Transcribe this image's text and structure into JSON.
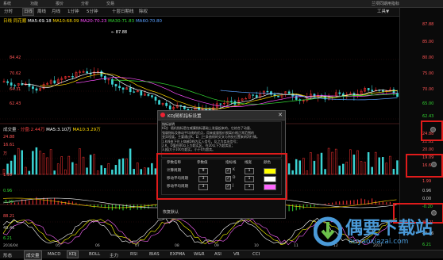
{
  "menu": {
    "items": [
      "系统",
      "功能",
      "报价",
      "分析",
      "交易"
    ],
    "right": "兰坝同期用指标"
  },
  "toolbar": {
    "buttons": [
      {
        "label": "分时",
        "active": false
      },
      {
        "label": "日线",
        "active": true
      },
      {
        "label": "周线",
        "active": false
      },
      {
        "label": "月线",
        "active": false
      },
      {
        "label": "1分钟",
        "active": false
      },
      {
        "label": "5分钟",
        "active": false
      },
      {
        "label": "十层日期线",
        "active": false
      },
      {
        "label": "除权",
        "active": false
      }
    ],
    "right_label": "工具▼"
  },
  "price_panel": {
    "legend_prefix": "日线 同花顺",
    "ma": [
      {
        "label": "MA5:69.18",
        "color": "#ffffff"
      },
      {
        "label": "MA10:68.09",
        "color": "#ffd700"
      },
      {
        "label": "MA20:70.23",
        "color": "#ff4fff"
      },
      {
        "label": "MA30:71.83",
        "color": "#33d833"
      },
      {
        "label": "MA60:70.80",
        "color": "#5aa0ff"
      }
    ],
    "peak_label": "← 87.88",
    "axis": [
      "84.42",
      "70.62",
      "64.31",
      "62.43"
    ]
  },
  "volume_panel": {
    "legend_prefix": "成交量",
    "items": [
      {
        "label": "· 分盘:2.44万",
        "color": "#ff4444"
      },
      {
        "label": "MA5:3.10万",
        "color": "#ffffff"
      },
      {
        "label": "MA10:3.29万",
        "color": "#ffd700"
      }
    ],
    "axis": [
      "24.88",
      "16.61",
      "万"
    ]
  },
  "macd_panel": {
    "axis": [
      "1.99",
      "0.96",
      "-0.20"
    ]
  },
  "kdj_panel": {
    "axis": [
      "88.21",
      "49.46",
      "6.21"
    ]
  },
  "date_axis": [
    "2016/04",
    "05",
    "06",
    "07",
    "08",
    "09",
    "10",
    "11",
    "12",
    "2017"
  ],
  "right_axis": {
    "price": [
      "87.88",
      "85.00",
      "80.00",
      "75.00",
      "70.00",
      "65.00",
      "62.43"
    ],
    "volume": [
      "24.88",
      "22.82",
      "20.00",
      "19.09",
      "16.61"
    ],
    "macd": [
      "1.99",
      "0.96",
      "0.00",
      "-0.20"
    ],
    "kdj": [
      "88.21",
      "49.46",
      "6.21"
    ]
  },
  "dialog": {
    "title": "KDJ随机指标设置",
    "close": "✕",
    "desc_title": "指标说明",
    "desc_lines": [
      "KDJ：随机指标是在威廉指标基础上发展起来的，它综合了动量、",
      "强弱指标及移动平均线的优点，用来度量股价脱离价格正常范围的",
      "变异程度。主要通过K、D、J三条曲线的交叉与所处位置来研判行情。",
      "1.K线由下往上穿越D线为买入信号，反之为卖出信号；",
      "2.K、D值在80以上为超买区，在20以下为超卖区；",
      "3.J值大于100为超买，小于0为超卖。"
    ],
    "param_headers": [
      "参数名称",
      "参数值",
      "指标线",
      "线宽",
      "颜色"
    ],
    "params": [
      {
        "name": "计算周期",
        "value": "9",
        "line": "K",
        "width": "1",
        "color": "#ffff00"
      },
      {
        "name": "移动平均周期",
        "value": "3",
        "line": "D",
        "width": "1",
        "color": "#ffffff"
      },
      {
        "name": "移动平均周期",
        "value": "3",
        "line": "J",
        "width": "1",
        "color": "#ff66ff"
      }
    ],
    "reset": "恢复默认"
  },
  "bottom_tabs": [
    {
      "label": "形态",
      "active": false
    },
    {
      "label": "成交量",
      "active": true
    },
    {
      "label": "MACD",
      "active": false
    },
    {
      "label": "KDJ",
      "active": true
    },
    {
      "label": "BOLL",
      "active": false
    },
    {
      "label": "主力",
      "active": false
    },
    {
      "label": "RSI",
      "active": false
    },
    {
      "label": "BIAS",
      "active": false
    },
    {
      "label": "EXPMA",
      "active": false
    },
    {
      "label": "W&R",
      "active": false
    },
    {
      "label": "ASI",
      "active": false
    },
    {
      "label": "VR",
      "active": false
    },
    {
      "label": "CCI",
      "active": false
    }
  ],
  "watermark": {
    "title": "偶要下载站",
    "url": "ouyaoxiazai.com"
  },
  "colors": {
    "up": "#ff3333",
    "down": "#3cd4d4",
    "highlight": "#e01b1b"
  }
}
